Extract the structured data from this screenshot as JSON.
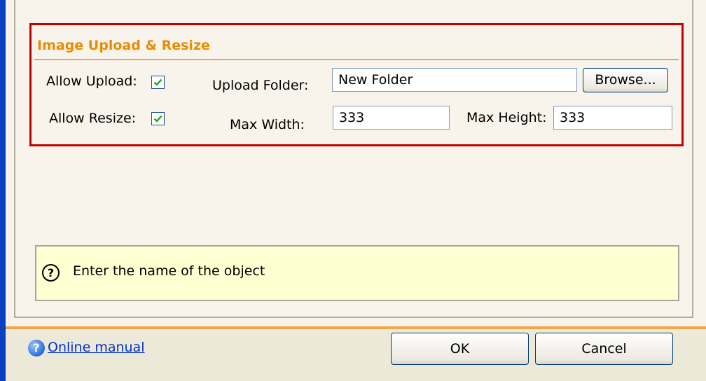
{
  "group": {
    "title": "Image Upload & Resize",
    "allow_upload_label": "Allow Upload:",
    "allow_upload_checked": true,
    "allow_resize_label": "Allow Resize:",
    "allow_resize_checked": true,
    "upload_folder_label": "Upload Folder:",
    "upload_folder_value": "New Folder",
    "browse_label": "Browse...",
    "max_width_label": "Max Width:",
    "max_width_value": "333",
    "max_height_label": "Max Height:",
    "max_height_value": "333"
  },
  "hint": {
    "icon": "question-circle-icon",
    "text": "Enter the name of the object"
  },
  "footer": {
    "manual_icon": "help-circle-icon",
    "manual_label": "Online manual",
    "ok_label": "OK",
    "cancel_label": "Cancel"
  },
  "colors": {
    "group_border": "#c30000",
    "group_title": "#e98c00",
    "hint_background": "#ffffd2",
    "link": "#0033cc"
  }
}
